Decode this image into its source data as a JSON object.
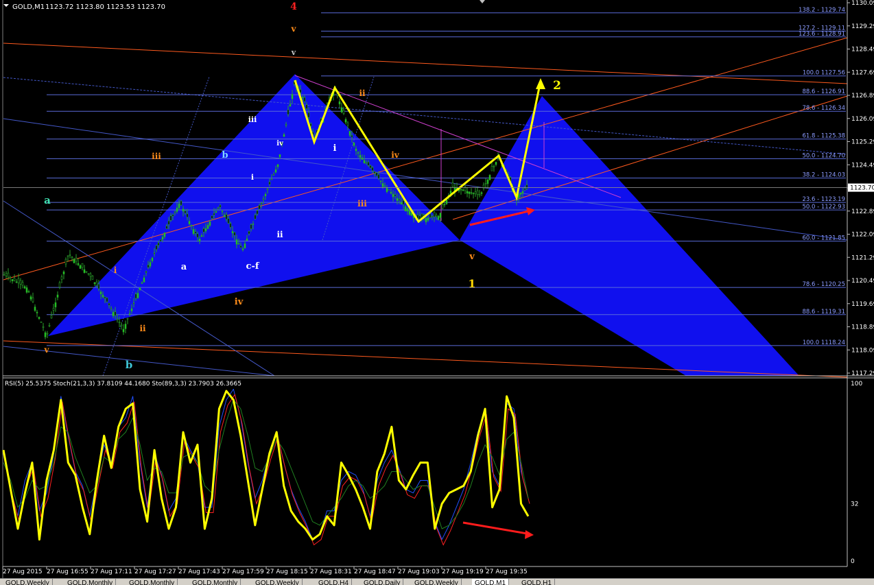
{
  "header": {
    "symbol": "GOLD,M1",
    "ohlc": "1123.72 1123.80 1123.53 1123.70"
  },
  "indicator_header": "RSI(5) 25.5375  Stoch(21,3,3) 37.8109 44.1680  Sto(89,3,3) 23.7903 26.3665",
  "colors": {
    "background": "#000000",
    "pattern_fill": "#1010ee",
    "zigzag": "#ffff00",
    "fib_lines": "#5a6bd8",
    "fib_text": "#8c9cff",
    "trend_orange": "#ff5a1e",
    "magenta": "#d040d0",
    "arrow_red": "#ff1c1c",
    "rsi": "#ffff00",
    "stoch_fast": "#2050ff",
    "stoch_signal": "#ff2020",
    "stoch_slow": "#208020",
    "grid_text": "#ffffff"
  },
  "chart_data": [
    {
      "type": "candlestick",
      "title": "GOLD,M1",
      "ylim": [
        1117.29,
        1130.09
      ],
      "price_axis_ticks": [
        "1130.09",
        "1129.29",
        "1128.49",
        "1127.69",
        "1126.89",
        "1126.09",
        "1125.29",
        "1124.49",
        "1123.69",
        "1122.89",
        "1122.09",
        "1121.29",
        "1120.49",
        "1119.69",
        "1118.89",
        "1118.09",
        "1117.29"
      ],
      "current_price": "1123.70",
      "time_axis_ticks": [
        "27 Aug 2015",
        "27 Aug 16:55",
        "27 Aug 17:11",
        "27 Aug 17:27",
        "27 Aug 17:43",
        "27 Aug 17:59",
        "27 Aug 18:15",
        "27 Aug 18:31",
        "27 Aug 18:47",
        "27 Aug 19:03",
        "27 Aug 19:19",
        "27 Aug 19:35"
      ],
      "fib_levels": [
        {
          "label": "138.2 - 1129.74",
          "price": 1129.74
        },
        {
          "label": "127.2 - 1129.11",
          "price": 1129.11
        },
        {
          "label": "123.6 - 1128.91",
          "price": 1128.91
        },
        {
          "label": "100.0 1127.56",
          "price": 1127.56
        },
        {
          "label": "88.6 - 1126.91",
          "price": 1126.91
        },
        {
          "label": "78.6 - 1126.34",
          "price": 1126.34
        },
        {
          "label": "61.8 - 1125.38",
          "price": 1125.38
        },
        {
          "label": "50.0 - 1124.70",
          "price": 1124.7
        },
        {
          "label": "38.2 - 1124.03",
          "price": 1124.03
        },
        {
          "label": "23.6 - 1123.19",
          "price": 1123.19
        },
        {
          "label": "50.0 - 1122.93",
          "price": 1122.93
        },
        {
          "label": "60.0 - 1121.85",
          "price": 1121.85
        },
        {
          "label": "78.6 - 1120.25",
          "price": 1120.25
        },
        {
          "label": "88.6 - 1119.31",
          "price": 1119.31
        },
        {
          "label": "100.0 1118.24",
          "price": 1118.24
        }
      ],
      "wave_labels": [
        {
          "text": "4",
          "color": "#ff2020"
        },
        {
          "text": "v",
          "color": "#ff8c1a"
        },
        {
          "text": "v",
          "color": "#c8c8c8"
        },
        {
          "text": "iii",
          "color": "#ff8c1a"
        },
        {
          "text": "iii",
          "color": "#ffffff"
        },
        {
          "text": "b",
          "color": "#80d8ff"
        },
        {
          "text": "iv",
          "color": "#ffffff"
        },
        {
          "text": "i",
          "color": "#ffffff"
        },
        {
          "text": "i",
          "color": "#ffffff"
        },
        {
          "text": "ii",
          "color": "#ff8c1a"
        },
        {
          "text": "i",
          "color": "#ff8c1a"
        },
        {
          "text": "iv",
          "color": "#ff8c1a"
        },
        {
          "text": "iii",
          "color": "#ff8c1a"
        },
        {
          "text": "a",
          "color": "#40e0b0"
        },
        {
          "text": "a",
          "color": "#ffffff"
        },
        {
          "text": "c-f",
          "color": "#ffffff"
        },
        {
          "text": "ii",
          "color": "#ffffff"
        },
        {
          "text": "ii",
          "color": "#ff8c1a"
        },
        {
          "text": "iv",
          "color": "#ff8c1a"
        },
        {
          "text": "v",
          "color": "#ff8c1a"
        },
        {
          "text": "v",
          "color": "#ff8c1a"
        },
        {
          "text": "1",
          "color": "#ffd700"
        },
        {
          "text": "b",
          "color": "#40c8d8"
        },
        {
          "text": "2",
          "color": "#ffff00"
        }
      ]
    },
    {
      "type": "line",
      "title": "RSI(5) / Stoch(21,3,3) / Sto(89,3,3)",
      "ylim": [
        0,
        100
      ],
      "axis_ticks": [
        "100",
        "32",
        "0"
      ],
      "series": [
        {
          "name": "RSI(5)",
          "values": [
            62,
            40,
            18,
            38,
            55,
            12,
            45,
            62,
            90,
            55,
            48,
            30,
            15,
            45,
            70,
            52,
            75,
            85,
            88,
            40,
            22,
            62,
            35,
            18,
            30,
            72,
            55,
            65,
            18,
            35,
            85,
            95,
            90,
            70,
            45,
            20,
            40,
            60,
            72,
            42,
            28,
            22,
            18,
            12,
            15,
            25,
            20,
            55,
            48,
            40,
            30,
            18,
            50,
            60,
            75,
            45,
            40,
            48,
            55,
            55,
            18,
            32,
            38,
            40,
            42,
            50,
            70,
            85,
            30,
            40,
            92,
            80,
            32,
            25
          ]
        },
        {
          "name": "Stoch(21,3,3)",
          "values": [
            60,
            40,
            25,
            45,
            55,
            28,
            38,
            60,
            92,
            70,
            50,
            42,
            25,
            45,
            65,
            55,
            75,
            80,
            92,
            55,
            30,
            60,
            48,
            28,
            35,
            70,
            62,
            55,
            30,
            30,
            75,
            90,
            96,
            80,
            55,
            35,
            45,
            60,
            72,
            55,
            40,
            30,
            22,
            12,
            15,
            28,
            28,
            45,
            50,
            48,
            40,
            25,
            45,
            55,
            62,
            52,
            40,
            38,
            45,
            45,
            22,
            12,
            20,
            30,
            40,
            55,
            72,
            85,
            50,
            42,
            88,
            85,
            50,
            35
          ]
        },
        {
          "name": "Sto(89,3,3)",
          "values": [
            55,
            45,
            30,
            35,
            45,
            40,
            42,
            55,
            75,
            72,
            58,
            48,
            38,
            42,
            58,
            55,
            68,
            72,
            80,
            65,
            45,
            52,
            50,
            38,
            38,
            58,
            60,
            55,
            42,
            38,
            62,
            78,
            90,
            85,
            70,
            52,
            50,
            58,
            68,
            62,
            52,
            42,
            32,
            22,
            20,
            25,
            30,
            35,
            42,
            45,
            42,
            35,
            38,
            42,
            50,
            50,
            45,
            40,
            42,
            42,
            30,
            18,
            20,
            25,
            32,
            42,
            55,
            65,
            58,
            48,
            68,
            72,
            55,
            35
          ]
        }
      ]
    }
  ],
  "bottom_tabs": [
    "GOLD,Weekly",
    "GOLD,Monthly",
    "GOLD,Monthly",
    "GOLD,Monthly",
    "GOLD,Weekly",
    "GOLD,H4",
    "GOLD,Daily",
    "GOLD,Weekly",
    "GOLD,M1",
    "GOLD,H1"
  ],
  "active_tab": "GOLD,M1"
}
